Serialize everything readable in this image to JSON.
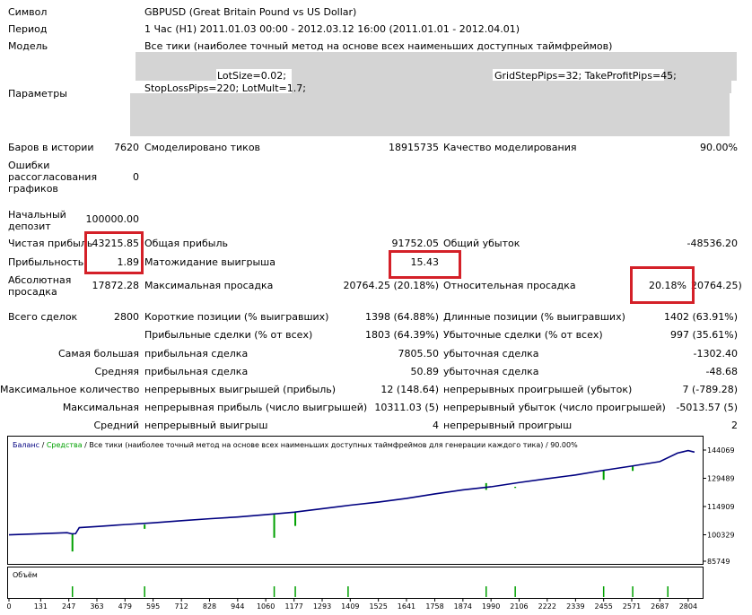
{
  "header": {
    "symbol_label": "Символ",
    "symbol_value": "GBPUSD (Great Britain Pound vs US Dollar)",
    "period_label": "Период",
    "period_value": "1 Час (H1) 2011.01.03 00:00 - 2012.03.12 16:00 (2011.01.01 - 2012.04.01)",
    "model_label": "Модель",
    "model_value": "Все тики (наиболее точный метод на основе всех наименьших доступных таймфреймов)",
    "params_label": "Параметры",
    "params_lotsize": "LotSize=0.02;",
    "params_grid": "GridStepPips=32; TakeProfitPips=45;",
    "params_stoploss": "StopLossPips=220; LotMult=1.7;"
  },
  "quality": {
    "bars_label": "Баров в истории",
    "bars_value": "7620",
    "ticks_label": "Смоделировано тиков",
    "ticks_value": "18915735",
    "quality_label": "Качество моделирования",
    "quality_value": "90.00%"
  },
  "errors": {
    "label": "Ошибки рассогласования графиков",
    "value": "0"
  },
  "deposit": {
    "label": "Начальный депозит",
    "value": "100000.00"
  },
  "profit": {
    "net_label": "Чистая прибыль",
    "net_value": "43215.85",
    "gross_label": "Общая прибыль",
    "gross_value": "91752.05",
    "loss_label": "Общий убыток",
    "loss_value": "-48536.20"
  },
  "factor": {
    "pf_label": "Прибыльность",
    "pf_value": "1.89",
    "exp_label": "Матожидание выигрыша",
    "exp_value": "15.43"
  },
  "drawdown": {
    "abs_label": "Абсолютная просадка",
    "abs_value": "17872.28",
    "max_label": "Максимальная просадка",
    "max_value": "20764.25 (20.18%)",
    "rel_label": "Относительная просадка",
    "rel_pct": "20.18%",
    "rel_abs": "20764.25)"
  },
  "trades": {
    "total_label": "Всего сделок",
    "total_value": "2800",
    "short_label": "Короткие позиции (% выигравших)",
    "short_value": "1398 (64.88%)",
    "long_label": "Длинные позиции (% выигравших)",
    "long_value": "1402 (63.91%)",
    "profit_trades_label": "Прибыльные сделки (% от всех)",
    "profit_trades_value": "1803 (64.39%)",
    "loss_trades_label": "Убыточные сделки (% от всех)",
    "loss_trades_value": "997 (35.61%)",
    "largest_label": "Самая большая",
    "largest_profit_label": "прибыльная сделка",
    "largest_profit_value": "7805.50",
    "largest_loss_label": "убыточная сделка",
    "largest_loss_value": "-1302.40",
    "average_label": "Средняя",
    "avg_profit_label": "прибыльная сделка",
    "avg_profit_value": "50.89",
    "avg_loss_label": "убыточная сделка",
    "avg_loss_value": "-48.68",
    "maxcount_label": "Максимальное количество",
    "mc_wins_label": "непрерывных выигрышей (прибыль)",
    "mc_wins_value": "12 (148.64)",
    "mc_losses_label": "непрерывных проигрышей (убыток)",
    "mc_losses_value": "7 (-789.28)",
    "maximal_label": "Максимальная",
    "mx_profit_label": "непрерывная прибыль (число выигрышей)",
    "mx_profit_value": "10311.03 (5)",
    "mx_loss_label": "непрерывный убыток (число проигрышей)",
    "mx_loss_value": "-5013.57 (5)",
    "avg2_label": "Средний",
    "avg_win_label": "непрерывный выигрыш",
    "avg_win_value": "4",
    "avg_loss2_label": "непрерывный проигрыш",
    "avg_loss2_value": "2"
  },
  "colors": {
    "balance": "#000080",
    "equity": "#00a000",
    "highlight": "#d42028"
  },
  "chart_data": {
    "type": "line",
    "legend_balance": "Баланс",
    "legend_sep": " / ",
    "legend_equity": "Средства",
    "legend_rest": " / Все тики (наиболее точный метод на основе всех наименьших доступных таймфреймов для генерации каждого тика) / 90.00%",
    "volume_label": "Объём",
    "x_ticks": [
      "0",
      "131",
      "247",
      "363",
      "479",
      "595",
      "712",
      "828",
      "944",
      "1060",
      "1177",
      "1293",
      "1409",
      "1525",
      "1641",
      "1758",
      "1874",
      "1990",
      "2106",
      "2222",
      "2339",
      "2455",
      "2571",
      "2687",
      "2804"
    ],
    "y_ticks": [
      "144069",
      "129489",
      "114909",
      "100329",
      "85749"
    ],
    "ylim": [
      85749,
      144069
    ],
    "xlim": [
      0,
      2860
    ],
    "balance": [
      [
        0,
        100300
      ],
      [
        131,
        100900
      ],
      [
        240,
        101400
      ],
      [
        260,
        100800
      ],
      [
        275,
        100900
      ],
      [
        290,
        104000
      ],
      [
        363,
        104600
      ],
      [
        479,
        105600
      ],
      [
        595,
        106500
      ],
      [
        712,
        107600
      ],
      [
        828,
        108600
      ],
      [
        944,
        109500
      ],
      [
        1060,
        110700
      ],
      [
        1177,
        112000
      ],
      [
        1293,
        113800
      ],
      [
        1409,
        115600
      ],
      [
        1525,
        117200
      ],
      [
        1641,
        119100
      ],
      [
        1758,
        121400
      ],
      [
        1874,
        123500
      ],
      [
        1990,
        125100
      ],
      [
        2106,
        127300
      ],
      [
        2222,
        129300
      ],
      [
        2339,
        131200
      ],
      [
        2455,
        133600
      ],
      [
        2571,
        135800
      ],
      [
        2687,
        138100
      ],
      [
        2760,
        142500
      ],
      [
        2804,
        143800
      ],
      [
        2830,
        143000
      ]
    ],
    "equity_dips": [
      [
        262,
        91700
      ],
      [
        560,
        103400
      ],
      [
        1095,
        98800
      ],
      [
        1182,
        104900
      ],
      [
        1970,
        127000
      ],
      [
        2090,
        124500
      ],
      [
        2455,
        128700
      ],
      [
        2575,
        133300
      ]
    ],
    "volume_spikes": [
      262,
      560,
      1095,
      1182,
      1400,
      1970,
      2090,
      2455,
      2575,
      2720
    ]
  }
}
